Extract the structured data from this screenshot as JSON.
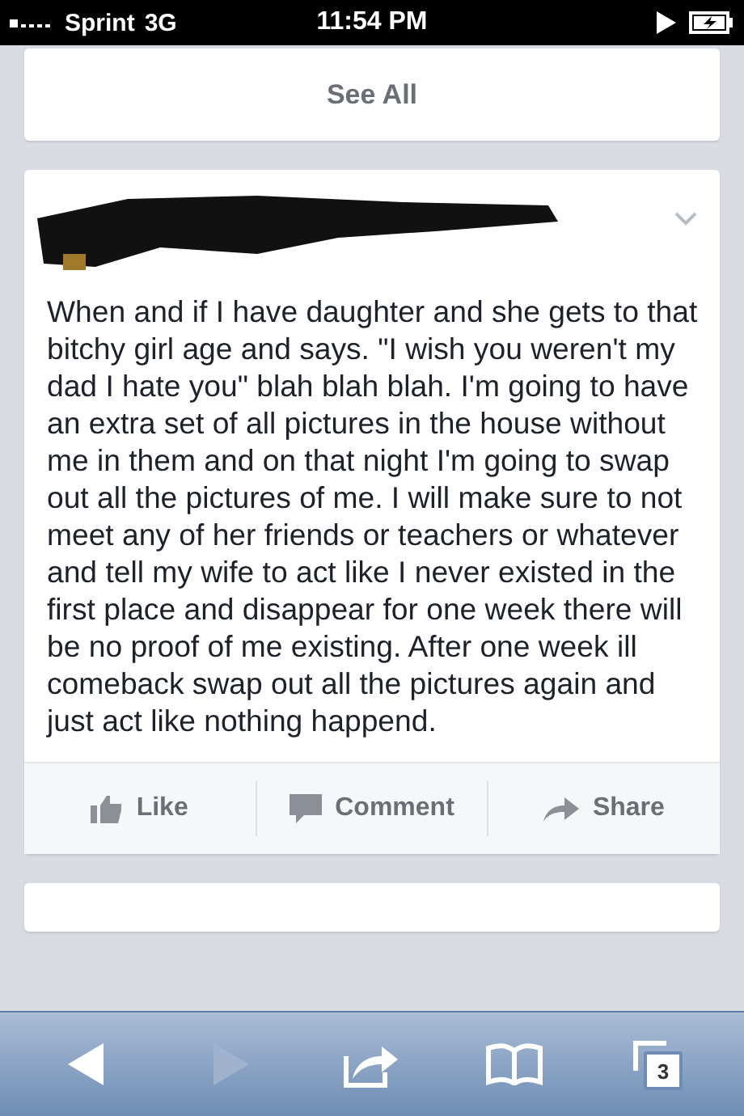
{
  "status_bar": {
    "carrier": "Sprint",
    "network": "3G",
    "time": "11:54 PM"
  },
  "see_all": {
    "label": "See All"
  },
  "post": {
    "text": "When and if I have daughter and she gets to that bitchy girl age and says. \"I wish you weren't my dad I hate you\" blah blah blah. I'm going to have an extra set of all pictures in the house without me in them and on that night I'm going to swap out all the pictures of me. I will make sure to not meet any of her friends or teachers or whatever and tell my wife to act like I never existed in the first place and disappear for one week there will be no proof of me existing. After one week ill comeback swap out all the pictures again and just act like nothing happend.",
    "actions": [
      {
        "kind": "like",
        "label": "Like"
      },
      {
        "kind": "comment",
        "label": "Comment"
      },
      {
        "kind": "share",
        "label": "Share"
      }
    ]
  },
  "toolbar": [
    {
      "kind": "back",
      "disabled": false
    },
    {
      "kind": "forward",
      "disabled": true
    },
    {
      "kind": "share",
      "disabled": false
    },
    {
      "kind": "bookmarks",
      "disabled": false
    },
    {
      "kind": "tabs",
      "disabled": false,
      "count": "3"
    }
  ]
}
